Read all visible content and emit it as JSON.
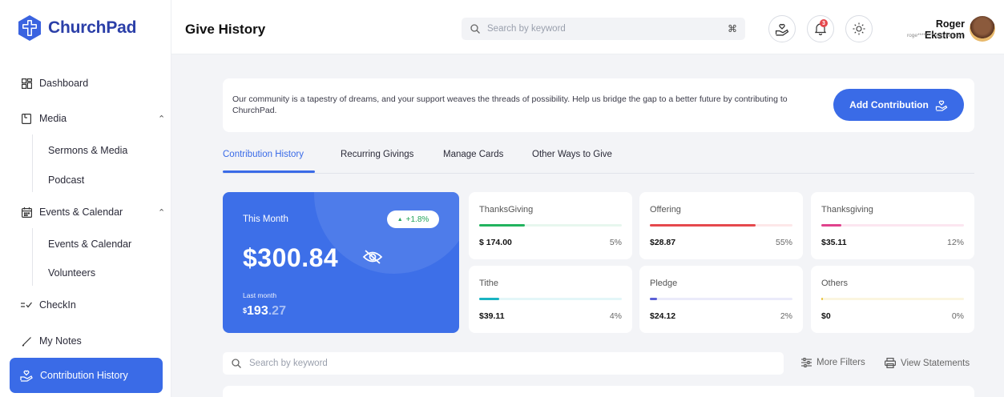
{
  "brand": {
    "name_part1": "Church",
    "name_part2": "Pad"
  },
  "sidebar": {
    "items": [
      {
        "label": "Dashboard",
        "icon": "dashboard-icon"
      },
      {
        "label": "Media",
        "icon": "media-icon"
      },
      {
        "label": "Events & Calendar",
        "icon": "calendar-icon"
      },
      {
        "label": "CheckIn",
        "icon": "checkin-icon"
      },
      {
        "label": "My Notes",
        "icon": "pencil-icon"
      },
      {
        "label": "Contribution History",
        "icon": "hand-heart-icon"
      }
    ],
    "media_sub": [
      "Sermons & Media",
      "Podcast"
    ],
    "events_sub": [
      "Events & Calendar",
      "Volunteers"
    ]
  },
  "header": {
    "title": "Give History",
    "search_placeholder": "Search by keyword",
    "shortcut": "⌘",
    "notification_count": "3",
    "user_name": "Roger Ekstrom",
    "user_email": "roge*********@gmail.com"
  },
  "banner": {
    "text": "Our community is a tapestry of dreams, and your support weaves the threads of possibility. Help us bridge the gap to a better future by contributing to ChurchPad.",
    "button": "Add Contribution"
  },
  "tabs": [
    "Contribution History",
    "Recurring Givings",
    "Manage Cards",
    "Other Ways to Give"
  ],
  "month": {
    "label": "This Month",
    "change": "+1.8%",
    "amount": "$300.84",
    "last_label": "Last month",
    "last_currency": "$",
    "last_int": "193",
    "last_dec": ".27"
  },
  "stats": [
    {
      "name": "ThanksGiving",
      "amount": "$ 174.00",
      "pct": "5%",
      "color": "#22b35e",
      "track": "#e7f7ee",
      "fill": 0.32
    },
    {
      "name": "Offering",
      "amount": "$28.87",
      "pct": "55%",
      "color": "#e5484d",
      "track": "#fde8e9",
      "fill": 0.74
    },
    {
      "name": "Thanksgiving",
      "amount": "$35.11",
      "pct": "12%",
      "color": "#e0428c",
      "track": "#fce6f0",
      "fill": 0.14
    },
    {
      "name": "Tithe",
      "amount": "$39.11",
      "pct": "4%",
      "color": "#19b3c2",
      "track": "#e3f6f8",
      "fill": 0.14
    },
    {
      "name": "Pledge",
      "amount": "$24.12",
      "pct": "2%",
      "color": "#5b5fd6",
      "track": "#ebebfa",
      "fill": 0.05
    },
    {
      "name": "Others",
      "amount": "$0",
      "pct": "0%",
      "color": "#e8c23a",
      "track": "#fbf5df",
      "fill": 0.0
    }
  ],
  "filters": {
    "search_placeholder": "Search by keyword",
    "more_filters": "More Filters",
    "view_statements": "View Statements"
  },
  "colors": {
    "accent": "#3a6be7",
    "brand": "#2b3fa8"
  }
}
